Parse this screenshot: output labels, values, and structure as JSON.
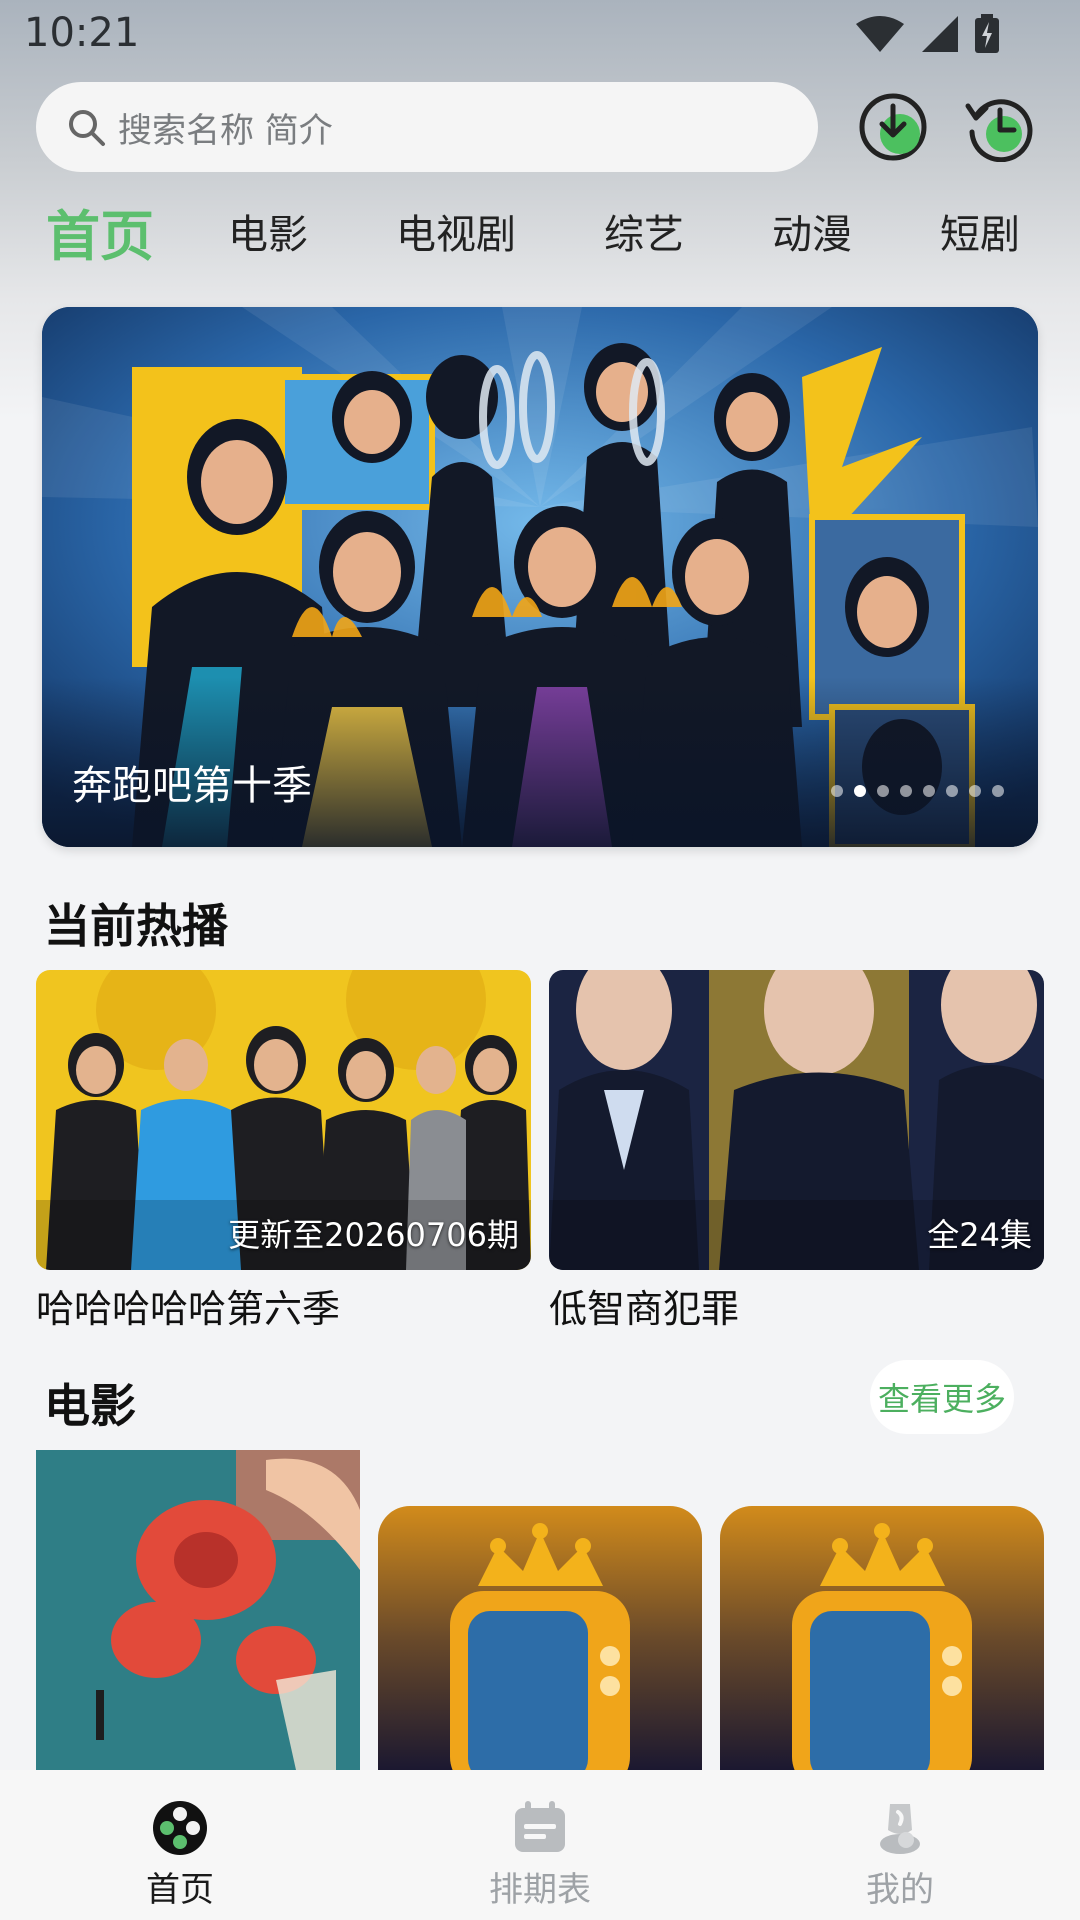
{
  "status_bar": {
    "time": "10:21"
  },
  "search": {
    "placeholder": "搜索名称 简介"
  },
  "header_actions": [
    {
      "icon": "download-icon",
      "color": "#4cc05f"
    },
    {
      "icon": "history-icon",
      "color": "#4cc05f"
    }
  ],
  "tabs": [
    {
      "label": "首页",
      "active": true
    },
    {
      "label": "电影",
      "active": false
    },
    {
      "label": "电视剧",
      "active": false
    },
    {
      "label": "综艺",
      "active": false
    },
    {
      "label": "动漫",
      "active": false
    },
    {
      "label": "短剧",
      "active": false
    }
  ],
  "banner": {
    "title": "奔跑吧第十季",
    "dot_count": 8,
    "active_dot": 2
  },
  "now_playing": {
    "title": "当前热播",
    "items": [
      {
        "title": "哈哈哈哈哈第六季",
        "badge": "更新至20260706期"
      },
      {
        "title": "低智商犯罪",
        "badge": "全24集"
      }
    ]
  },
  "movies": {
    "title": "电影",
    "see_more": "查看更多"
  },
  "bottom_nav": [
    {
      "label": "首页",
      "icon": "home-film-reel-icon",
      "active": true
    },
    {
      "label": "排期表",
      "icon": "schedule-icon",
      "active": false
    },
    {
      "label": "我的",
      "icon": "profile-icon",
      "active": false
    }
  ],
  "colors": {
    "accent": "#5cbf6e",
    "see_more": "#4caf5f",
    "nav_inactive": "#9ea2a6"
  }
}
